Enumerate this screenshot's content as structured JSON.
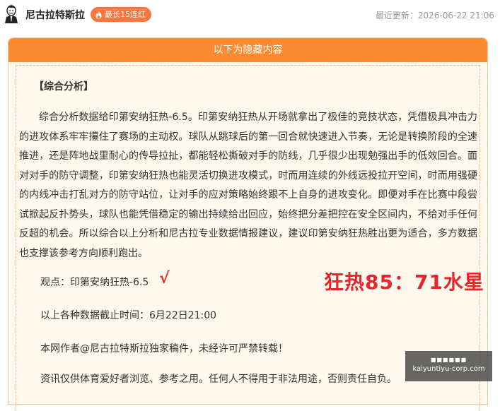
{
  "header": {
    "author": "尼古拉特斯拉",
    "streak_badge": "最长15连红",
    "updated": "最近更新：2026-06-22 21:06"
  },
  "panel": {
    "title": "以下为隐藏内容",
    "section_title": "【综合分析】",
    "analysis": "综合分析数据给印第安纳狂热-6.5。印第安纳狂热从开场就拿出了极佳的竞技状态，凭借极具冲击力的进攻体系牢牢攥住了赛场的主动权。球队从跳球后的第一回合就快速进入节奏，无论是转换阶段的全速推进，还是阵地战里耐心的传导拉扯，都能轻松撕破对手的防线，几乎很少出现勉强出手的低效回合。面对对手的防守调整，印第安纳狂热也能灵活切换进攻模式，时而用连续的外线远投拉开空间，时而用强硬的内线冲击打乱对方的防守站位，让对手的应对策略始终跟不上自身的进攻变化。即便对手在比赛中段尝试掀起反扑势头，球队也能凭借稳定的输出持续给出回应，始终把分差把控在安全区间内，不给对手任何反超的机会。所以综合以上分析和尼古拉专业数据情报建议，建议印第安纳狂热胜出更为适合，多方数据也支撑该参考方向顺利跑出。",
    "viewpoint": "观点：印第安纳狂热-6.5",
    "checkmark": "√",
    "score": "狂热85：71水星",
    "cutoff": "以上各种数据截止时间：6月22日21:00",
    "copyright": "本网作者@尼古拉特斯拉独家稿件，未经许可严禁转载！",
    "disclaimer": "资讯仅供体育爱好者浏览、参考之用。任何人不得用于非法用途，否则责任自负。"
  },
  "watermark": {
    "top": "■■■■■■",
    "domain": "kaiyuntiyu-corp.com"
  },
  "colors": {
    "accent": "#fb8a31",
    "badge": "#f9773f",
    "score_red": "#e8242c",
    "panel_bg": "#fff8ec"
  }
}
